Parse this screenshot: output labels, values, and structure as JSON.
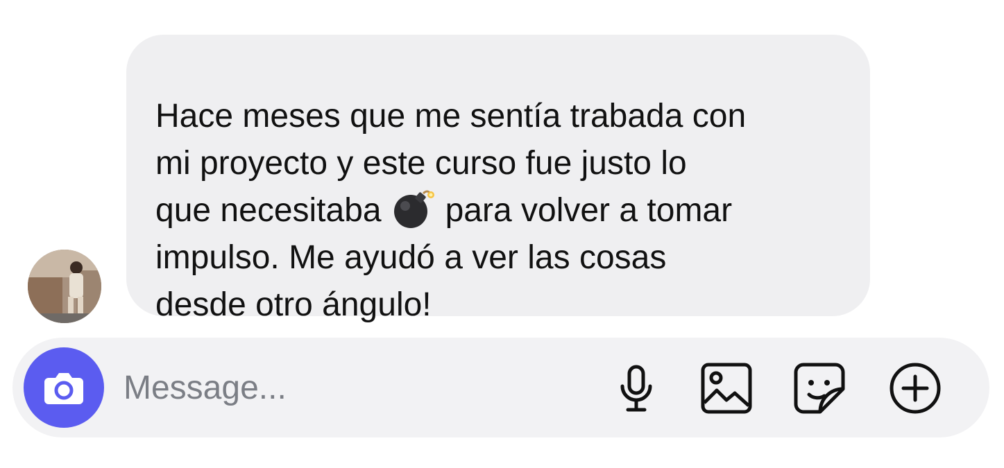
{
  "message": {
    "lines": [
      "Hace meses que me sentía trabada con",
      "mi proyecto y este curso fue justo lo",
      "que necesitaba",
      "para volver a tomar",
      "impulso. Me ayudó a ver las cosas",
      "desde otro ángulo!"
    ],
    "emoji": "bomb-emoji"
  },
  "composer": {
    "placeholder": "Message...",
    "value": "",
    "camera_icon": "camera-icon",
    "mic_icon": "microphone-icon",
    "gallery_icon": "image-icon",
    "sticker_icon": "sticker-icon",
    "plus_icon": "plus-circle-icon"
  },
  "colors": {
    "bubble": "#efeff1",
    "composer": "#f2f2f4",
    "camera_button": "#5b5cf0",
    "text": "#111111",
    "placeholder": "#7b7e85"
  }
}
